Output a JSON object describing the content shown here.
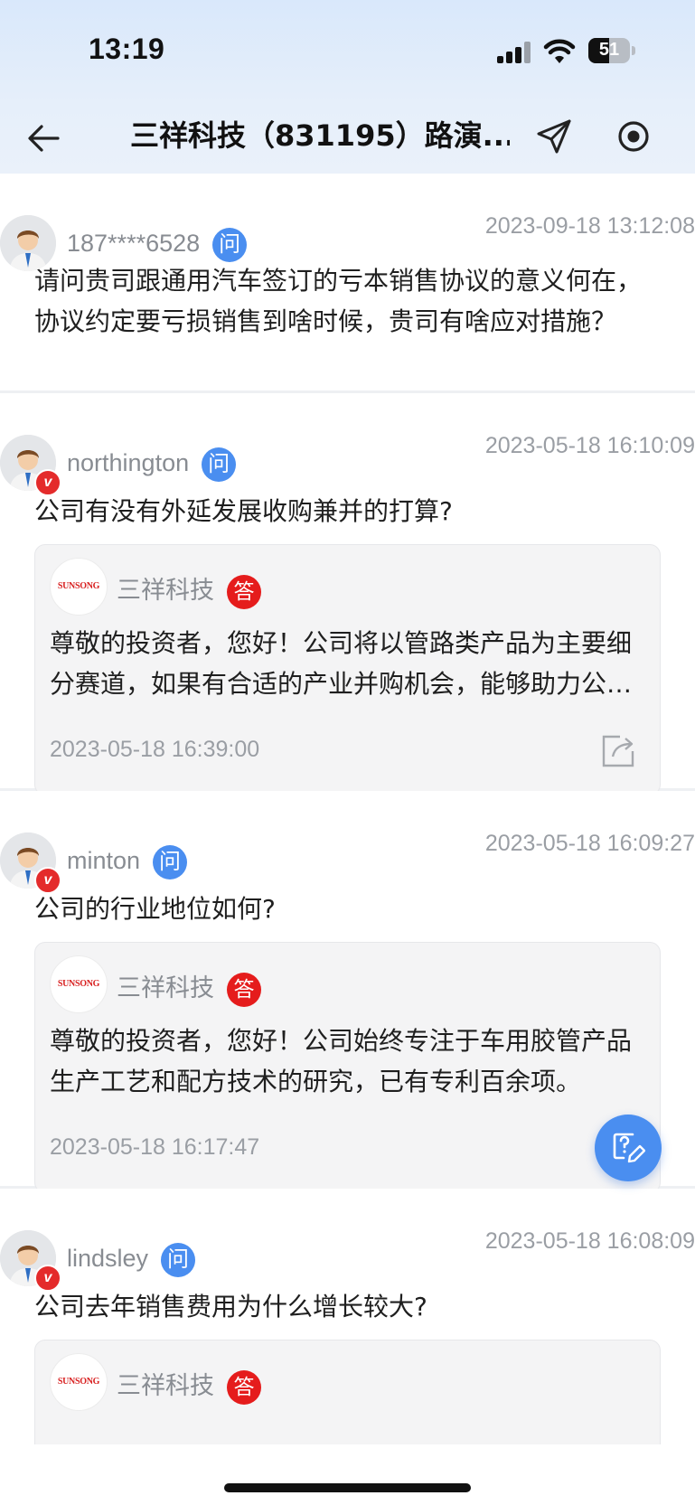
{
  "status_bar": {
    "time": "13:19",
    "battery": "51",
    "battery_level": 0.51
  },
  "nav": {
    "title": "三祥科技（831195）路演..."
  },
  "items": [
    {
      "user": "187****6528",
      "verified": false,
      "question_badge": "问",
      "time": "2023-09-18 13:12:08",
      "question": "请问贵司跟通用汽车签订的亏本销售协议的意义何在，协议约定要亏损销售到啥时候，贵司有啥应对措施？",
      "answer": null
    },
    {
      "user": "northington",
      "verified": true,
      "verified_mark": "v",
      "question_badge": "问",
      "time": "2023-05-18 16:10:09",
      "question": "公司有没有外延发展收购兼并的打算?",
      "answer": {
        "company": "三祥科技",
        "logo_text": "SUNSONG",
        "badge": "答",
        "text": "尊敬的投资者，您好！公司将以管路类产品为主要细分赛道，如果有合适的产业并购机会，能够助力公司发展。",
        "time": "2023-05-18 16:39:00"
      }
    },
    {
      "user": "minton",
      "verified": true,
      "verified_mark": "v",
      "question_badge": "问",
      "time": "2023-05-18 16:09:27",
      "question": "公司的行业地位如何?",
      "answer": {
        "company": "三祥科技",
        "logo_text": "SUNSONG",
        "badge": "答",
        "text": "尊敬的投资者，您好！公司始终专注于车用胶管产品生产工艺和配方技术的研究，已有专利百余项。",
        "time": "2023-05-18 16:17:47"
      }
    },
    {
      "user": "lindsley",
      "verified": true,
      "verified_mark": "v",
      "question_badge": "问",
      "time": "2023-05-18 16:08:09",
      "question": "公司去年销售费用为什么增长较大?",
      "answer": {
        "company": "三祥科技",
        "logo_text": "SUNSONG",
        "badge": "答",
        "text": "",
        "time": ""
      }
    }
  ],
  "colors": {
    "question_badge": "#4a8ef0",
    "answer_badge": "#e51c1c",
    "header_bg": "#dde9f9",
    "fab": "#4a8ef0"
  },
  "icons": {
    "back": "arrow-left-icon",
    "share": "paper-plane-icon",
    "record": "target-icon",
    "forward": "share-box-icon",
    "fab": "ask-edit-icon"
  }
}
